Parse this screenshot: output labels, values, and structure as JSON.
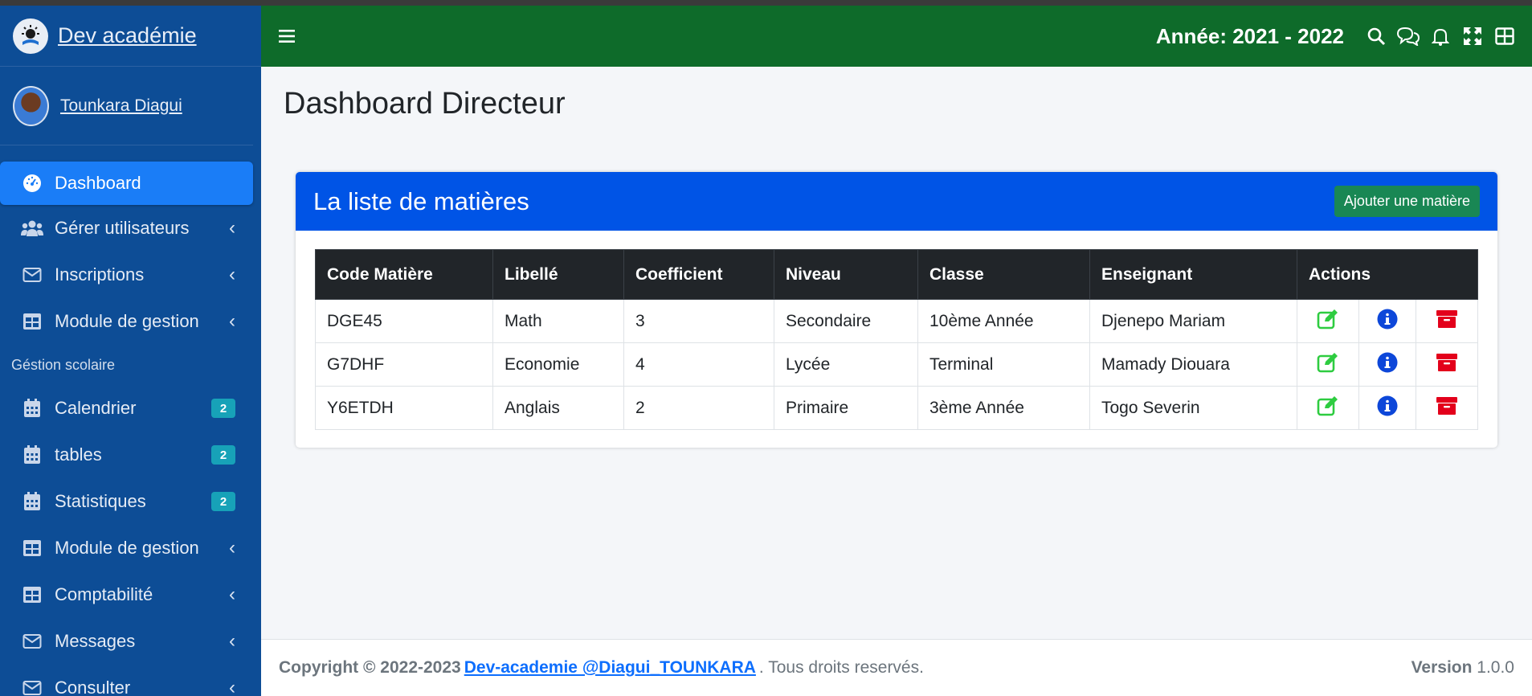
{
  "brand": {
    "name": "Dev académie"
  },
  "user": {
    "name": "Tounkara Diagui"
  },
  "sidebar": {
    "items": [
      {
        "label": "Dashboard"
      },
      {
        "label": "Gérer utilisateurs"
      },
      {
        "label": "Inscriptions"
      },
      {
        "label": "Module de gestion"
      }
    ],
    "section_header": "Géstion scolaire",
    "section_items": [
      {
        "label": "Calendrier",
        "badge": "2"
      },
      {
        "label": "tables",
        "badge": "2"
      },
      {
        "label": "Statistiques",
        "badge": "2"
      },
      {
        "label": "Module de gestion"
      },
      {
        "label": "Comptabilité"
      },
      {
        "label": "Messages"
      },
      {
        "label": "Consulter"
      }
    ]
  },
  "topbar": {
    "year": "Année: 2021 - 2022"
  },
  "page": {
    "title": "Dashboard Directeur"
  },
  "card": {
    "title": "La liste de matières",
    "add_button": "Ajouter une matière"
  },
  "table": {
    "headers": [
      "Code Matière",
      "Libellé",
      "Coefficient",
      "Niveau",
      "Classe",
      "Enseignant",
      "Actions"
    ],
    "rows": [
      {
        "code": "DGE45",
        "libelle": "Math",
        "coef": "3",
        "niveau": "Secondaire",
        "classe": "10ème Année",
        "enseignant": "Djenepo Mariam"
      },
      {
        "code": "G7DHF",
        "libelle": "Economie",
        "coef": "4",
        "niveau": "Lycée",
        "classe": "Terminal",
        "enseignant": "Mamady Diouara"
      },
      {
        "code": "Y6ETDH",
        "libelle": "Anglais",
        "coef": "2",
        "niveau": "Primaire",
        "classe": "3ème Année",
        "enseignant": "Togo Severin"
      }
    ]
  },
  "footer": {
    "copyright": "Copyright © 2022-2023",
    "link": "Dev-academie @Diagui_TOUNKARA",
    "rights": ". Tous droits reservés.",
    "version_label": "Version",
    "version": "1.0.0"
  },
  "colors": {
    "sidebar": "#0d4d96",
    "topbar": "#0e6b2a",
    "card_header": "#0054e6",
    "active": "#1a7df7",
    "edit": "#2ecc40",
    "info": "#0d47d9",
    "delete": "#e3001b"
  }
}
